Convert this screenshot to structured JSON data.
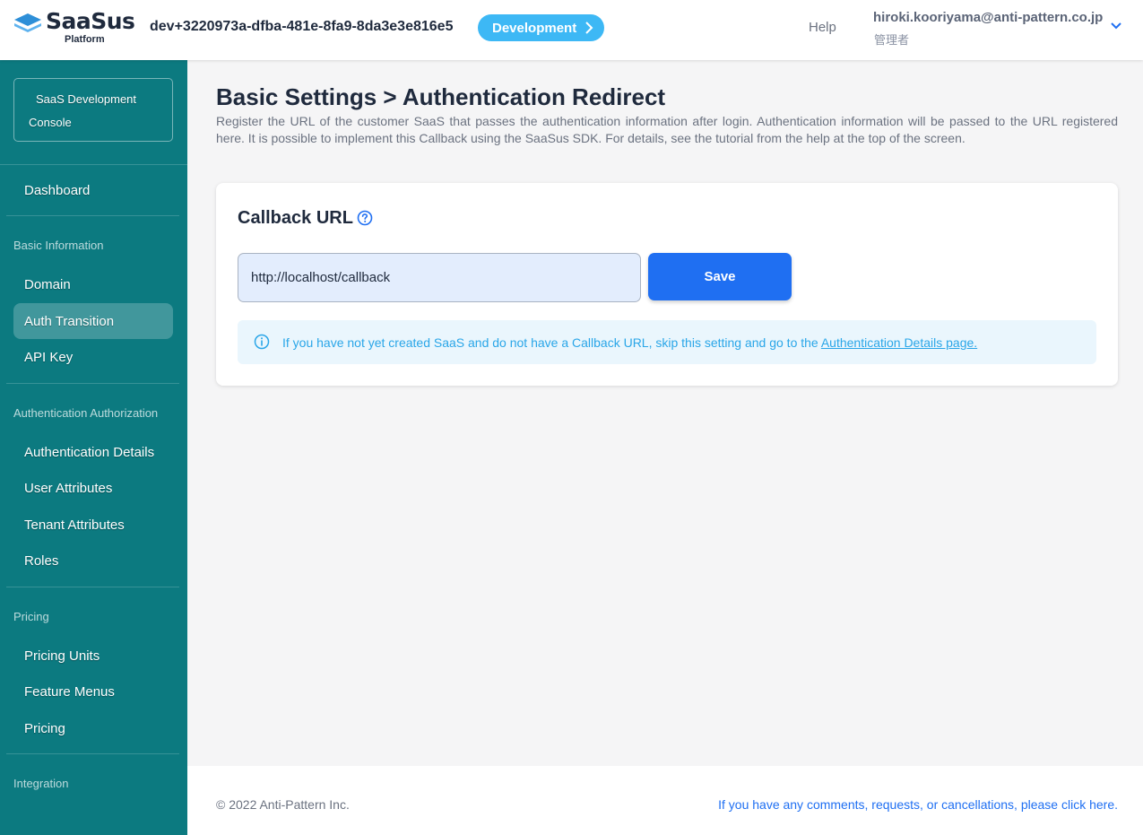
{
  "header": {
    "logo_text": "SaaSus",
    "logo_sub": "Platform",
    "env_id": "dev+3220973a-dfba-481e-8fa9-8da3e3e816e5",
    "env_button": "Development",
    "help": "Help",
    "user_email": "hiroki.kooriyama@anti-pattern.co.jp",
    "user_role": "管理者"
  },
  "sidebar": {
    "console_line1": "SaaS Development",
    "console_line2": "Console",
    "dashboard": "Dashboard",
    "groups": {
      "basic": "Basic Information",
      "auth": "Authentication Authorization",
      "pricing": "Pricing",
      "integration": "Integration"
    },
    "items": {
      "domain": "Domain",
      "auth_transition": "Auth Transition",
      "api_key": "API Key",
      "auth_details": "Authentication Details",
      "user_attributes": "User Attributes",
      "tenant_attributes": "Tenant Attributes",
      "roles": "Roles",
      "pricing_units": "Pricing Units",
      "feature_menus": "Feature Menus",
      "pricing": "Pricing"
    },
    "active_item": "Auth Transition"
  },
  "main": {
    "title": "Basic Settings > Authentication Redirect",
    "description": "Register the URL of the customer SaaS that passes the authentication information after login. Authentication information will be passed to the URL registered here. It is possible to implement this Callback using the SaaSus SDK. For details, see the tutorial from the help at the top of the screen.",
    "card": {
      "title": "Callback URL",
      "input_value": "http://localhost/callback",
      "save_label": "Save",
      "info_text": "If you have not yet created SaaS and do not have a Callback URL, skip this setting and go to the ",
      "info_link": "Authentication Details page."
    }
  },
  "footer": {
    "copyright": "© 2022 Anti-Pattern Inc.",
    "feedback": "If you have any comments, requests, or cancellations, please click here."
  },
  "colors": {
    "sidebar": "#0c7a80",
    "accent": "#1f6ff2",
    "env_badge": "#3db8f5",
    "info": "#2aa6e8"
  },
  "icons": {
    "logo": "logo-icon",
    "env_chevron": "chevron-right-icon",
    "user_chevron": "chevron-down-icon",
    "help": "question-circle-icon",
    "info": "info-circle-icon"
  }
}
